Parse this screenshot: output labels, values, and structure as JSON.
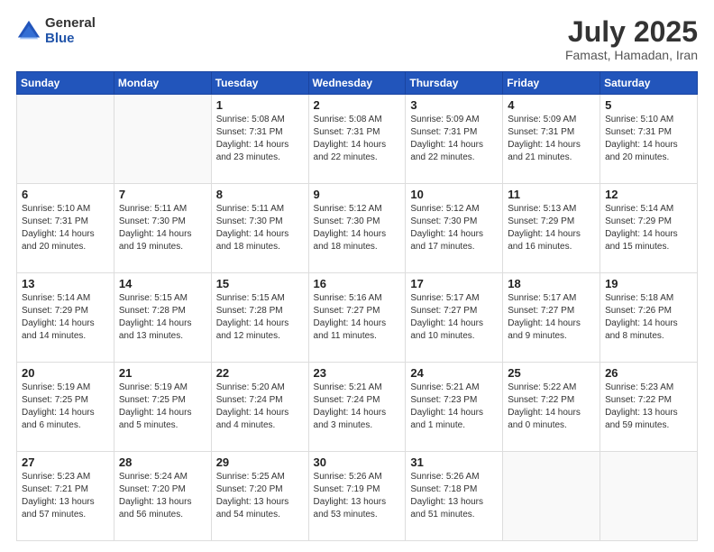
{
  "logo": {
    "general": "General",
    "blue": "Blue"
  },
  "header": {
    "month": "July 2025",
    "location": "Famast, Hamadan, Iran"
  },
  "weekdays": [
    "Sunday",
    "Monday",
    "Tuesday",
    "Wednesday",
    "Thursday",
    "Friday",
    "Saturday"
  ],
  "weeks": [
    [
      {
        "day": "",
        "sunrise": "",
        "sunset": "",
        "daylight": ""
      },
      {
        "day": "",
        "sunrise": "",
        "sunset": "",
        "daylight": ""
      },
      {
        "day": "1",
        "sunrise": "Sunrise: 5:08 AM",
        "sunset": "Sunset: 7:31 PM",
        "daylight": "Daylight: 14 hours and 23 minutes."
      },
      {
        "day": "2",
        "sunrise": "Sunrise: 5:08 AM",
        "sunset": "Sunset: 7:31 PM",
        "daylight": "Daylight: 14 hours and 22 minutes."
      },
      {
        "day": "3",
        "sunrise": "Sunrise: 5:09 AM",
        "sunset": "Sunset: 7:31 PM",
        "daylight": "Daylight: 14 hours and 22 minutes."
      },
      {
        "day": "4",
        "sunrise": "Sunrise: 5:09 AM",
        "sunset": "Sunset: 7:31 PM",
        "daylight": "Daylight: 14 hours and 21 minutes."
      },
      {
        "day": "5",
        "sunrise": "Sunrise: 5:10 AM",
        "sunset": "Sunset: 7:31 PM",
        "daylight": "Daylight: 14 hours and 20 minutes."
      }
    ],
    [
      {
        "day": "6",
        "sunrise": "Sunrise: 5:10 AM",
        "sunset": "Sunset: 7:31 PM",
        "daylight": "Daylight: 14 hours and 20 minutes."
      },
      {
        "day": "7",
        "sunrise": "Sunrise: 5:11 AM",
        "sunset": "Sunset: 7:30 PM",
        "daylight": "Daylight: 14 hours and 19 minutes."
      },
      {
        "day": "8",
        "sunrise": "Sunrise: 5:11 AM",
        "sunset": "Sunset: 7:30 PM",
        "daylight": "Daylight: 14 hours and 18 minutes."
      },
      {
        "day": "9",
        "sunrise": "Sunrise: 5:12 AM",
        "sunset": "Sunset: 7:30 PM",
        "daylight": "Daylight: 14 hours and 18 minutes."
      },
      {
        "day": "10",
        "sunrise": "Sunrise: 5:12 AM",
        "sunset": "Sunset: 7:30 PM",
        "daylight": "Daylight: 14 hours and 17 minutes."
      },
      {
        "day": "11",
        "sunrise": "Sunrise: 5:13 AM",
        "sunset": "Sunset: 7:29 PM",
        "daylight": "Daylight: 14 hours and 16 minutes."
      },
      {
        "day": "12",
        "sunrise": "Sunrise: 5:14 AM",
        "sunset": "Sunset: 7:29 PM",
        "daylight": "Daylight: 14 hours and 15 minutes."
      }
    ],
    [
      {
        "day": "13",
        "sunrise": "Sunrise: 5:14 AM",
        "sunset": "Sunset: 7:29 PM",
        "daylight": "Daylight: 14 hours and 14 minutes."
      },
      {
        "day": "14",
        "sunrise": "Sunrise: 5:15 AM",
        "sunset": "Sunset: 7:28 PM",
        "daylight": "Daylight: 14 hours and 13 minutes."
      },
      {
        "day": "15",
        "sunrise": "Sunrise: 5:15 AM",
        "sunset": "Sunset: 7:28 PM",
        "daylight": "Daylight: 14 hours and 12 minutes."
      },
      {
        "day": "16",
        "sunrise": "Sunrise: 5:16 AM",
        "sunset": "Sunset: 7:27 PM",
        "daylight": "Daylight: 14 hours and 11 minutes."
      },
      {
        "day": "17",
        "sunrise": "Sunrise: 5:17 AM",
        "sunset": "Sunset: 7:27 PM",
        "daylight": "Daylight: 14 hours and 10 minutes."
      },
      {
        "day": "18",
        "sunrise": "Sunrise: 5:17 AM",
        "sunset": "Sunset: 7:27 PM",
        "daylight": "Daylight: 14 hours and 9 minutes."
      },
      {
        "day": "19",
        "sunrise": "Sunrise: 5:18 AM",
        "sunset": "Sunset: 7:26 PM",
        "daylight": "Daylight: 14 hours and 8 minutes."
      }
    ],
    [
      {
        "day": "20",
        "sunrise": "Sunrise: 5:19 AM",
        "sunset": "Sunset: 7:25 PM",
        "daylight": "Daylight: 14 hours and 6 minutes."
      },
      {
        "day": "21",
        "sunrise": "Sunrise: 5:19 AM",
        "sunset": "Sunset: 7:25 PM",
        "daylight": "Daylight: 14 hours and 5 minutes."
      },
      {
        "day": "22",
        "sunrise": "Sunrise: 5:20 AM",
        "sunset": "Sunset: 7:24 PM",
        "daylight": "Daylight: 14 hours and 4 minutes."
      },
      {
        "day": "23",
        "sunrise": "Sunrise: 5:21 AM",
        "sunset": "Sunset: 7:24 PM",
        "daylight": "Daylight: 14 hours and 3 minutes."
      },
      {
        "day": "24",
        "sunrise": "Sunrise: 5:21 AM",
        "sunset": "Sunset: 7:23 PM",
        "daylight": "Daylight: 14 hours and 1 minute."
      },
      {
        "day": "25",
        "sunrise": "Sunrise: 5:22 AM",
        "sunset": "Sunset: 7:22 PM",
        "daylight": "Daylight: 14 hours and 0 minutes."
      },
      {
        "day": "26",
        "sunrise": "Sunrise: 5:23 AM",
        "sunset": "Sunset: 7:22 PM",
        "daylight": "Daylight: 13 hours and 59 minutes."
      }
    ],
    [
      {
        "day": "27",
        "sunrise": "Sunrise: 5:23 AM",
        "sunset": "Sunset: 7:21 PM",
        "daylight": "Daylight: 13 hours and 57 minutes."
      },
      {
        "day": "28",
        "sunrise": "Sunrise: 5:24 AM",
        "sunset": "Sunset: 7:20 PM",
        "daylight": "Daylight: 13 hours and 56 minutes."
      },
      {
        "day": "29",
        "sunrise": "Sunrise: 5:25 AM",
        "sunset": "Sunset: 7:20 PM",
        "daylight": "Daylight: 13 hours and 54 minutes."
      },
      {
        "day": "30",
        "sunrise": "Sunrise: 5:26 AM",
        "sunset": "Sunset: 7:19 PM",
        "daylight": "Daylight: 13 hours and 53 minutes."
      },
      {
        "day": "31",
        "sunrise": "Sunrise: 5:26 AM",
        "sunset": "Sunset: 7:18 PM",
        "daylight": "Daylight: 13 hours and 51 minutes."
      },
      {
        "day": "",
        "sunrise": "",
        "sunset": "",
        "daylight": ""
      },
      {
        "day": "",
        "sunrise": "",
        "sunset": "",
        "daylight": ""
      }
    ]
  ]
}
